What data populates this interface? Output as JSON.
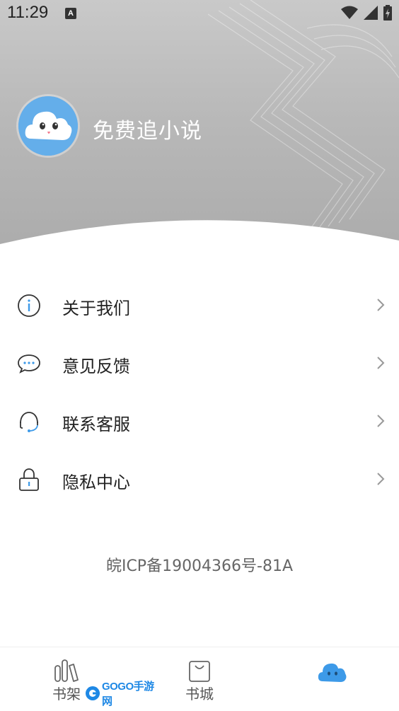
{
  "status_bar": {
    "time": "11:29",
    "notification_letter": "A"
  },
  "profile": {
    "app_name": "免费追小说"
  },
  "menu": [
    {
      "label": "关于我们",
      "icon": "info-icon"
    },
    {
      "label": "意见反馈",
      "icon": "chat-bubble-icon"
    },
    {
      "label": "联系客服",
      "icon": "headset-icon"
    },
    {
      "label": "隐私中心",
      "icon": "lock-icon"
    }
  ],
  "footer": {
    "icp": "皖ICP备19004366号-81A"
  },
  "tabbar": {
    "tabs": [
      {
        "label": "书架",
        "icon": "bookshelf-icon"
      },
      {
        "label": "书城",
        "icon": "shopping-bag-icon"
      },
      {
        "label": "",
        "icon": "cloud-mascot-icon",
        "active": true
      }
    ]
  },
  "watermark": {
    "text": "GOGO手游网"
  },
  "colors": {
    "header_gray": "#b8b8b8",
    "accent_blue": "#3d9ae8",
    "text_dark": "#222222",
    "text_muted": "#666666"
  }
}
